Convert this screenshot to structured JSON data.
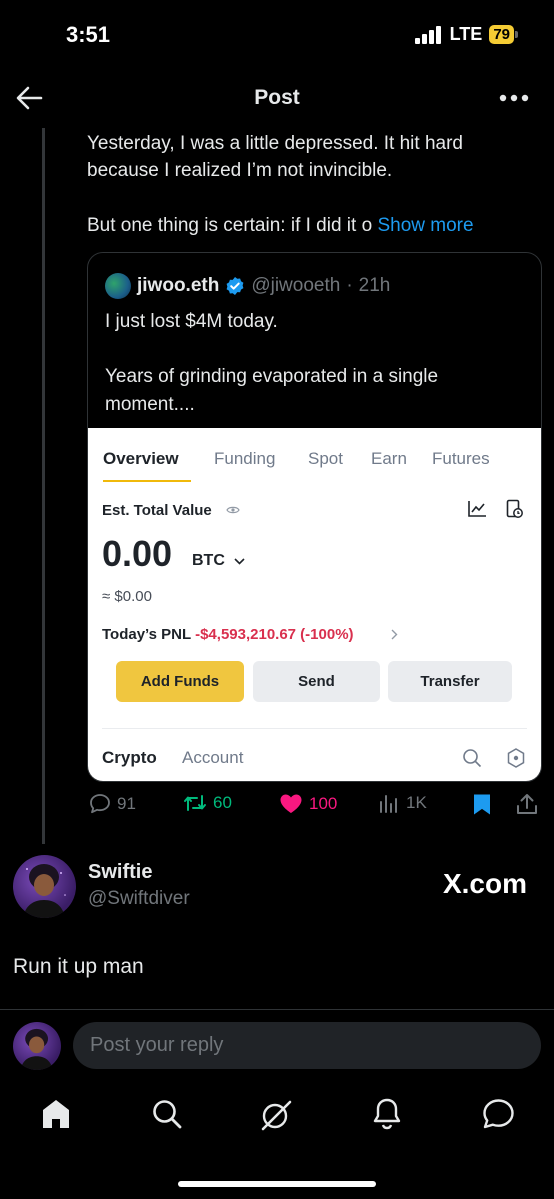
{
  "status_bar": {
    "time": "3:51",
    "network": "LTE",
    "battery": "79"
  },
  "header": {
    "title": "Post"
  },
  "post": {
    "line1": "Yesterday, I was a little depressed. It hit hard because I realized I’m not invincible.",
    "line2": "But one thing is certain: if I did it o",
    "show_more": "Show more"
  },
  "quote": {
    "name": "jiwoo.eth",
    "handle": "@jiwooeth",
    "dot": "·",
    "time": "21h",
    "text1": "I just lost $4M today.",
    "text2": "Years of grinding evaporated in a single moment....",
    "app": {
      "tabs": [
        "Overview",
        "Funding",
        "Spot",
        "Earn",
        "Futures"
      ],
      "est_label": "Est. Total Value",
      "value": "0.00",
      "currency": "BTC",
      "usd": "≈ $0.00",
      "pnl_label": "Today’s PNL",
      "pnl_value": "-$4,593,210.67 (-100%)",
      "buttons": [
        "Add Funds",
        "Send",
        "Transfer"
      ],
      "bottom_tabs": [
        "Crypto",
        "Account"
      ]
    }
  },
  "actions": {
    "replies": "91",
    "reposts": "60",
    "likes": "100",
    "views": "1K"
  },
  "reply": {
    "name": "Swiftie",
    "handle": "@Swiftdiver",
    "watermark": "X.com",
    "text": "Run it up man"
  },
  "composer": {
    "placeholder": "Post your reply"
  },
  "colors": {
    "accent": "#1d9bf0",
    "like": "#f91880",
    "repost": "#00ba7c",
    "binance_yellow": "#f0c63f",
    "pnl_red": "#d9304e"
  }
}
